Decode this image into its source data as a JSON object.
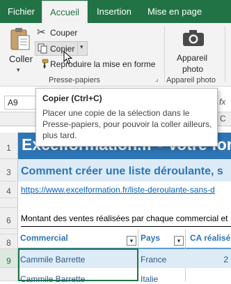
{
  "colors": {
    "excel_green": "#217346",
    "ribbon_bg": "#f3f3f3",
    "title_blue": "#2e75b5",
    "row_blue": "#ddebf7",
    "link_blue": "#0563c1"
  },
  "ribbon": {
    "tabs": [
      {
        "label": "Fichier",
        "active": false
      },
      {
        "label": "Accueil",
        "active": true
      },
      {
        "label": "Insertion",
        "active": false
      },
      {
        "label": "Mise en page",
        "active": false
      }
    ],
    "clipboard": {
      "paste_label": "Coller",
      "cut_label": "Couper",
      "copy_label": "Copier",
      "format_painter_label": "Reproduire la mise en forme",
      "group_label": "Presse-papiers"
    },
    "photo": {
      "button_line1": "Appareil",
      "button_line2": "photo",
      "group_label": "Appareil photo"
    }
  },
  "formula_bar": {
    "name_box": "A9",
    "fx": "fx"
  },
  "tooltip": {
    "title": "Copier (Ctrl+C)",
    "body": "Placer une copie de la sélection dans le Presse-papiers, pour pouvoir la coller ailleurs, plus tard."
  },
  "sheet": {
    "col_c_header": "C",
    "row_numbers": [
      "1",
      "3",
      "4",
      "6",
      "8",
      "9"
    ],
    "banner": "Excelformation.fr - Votre formation",
    "subtitle": "Comment créer une liste déroulante, s",
    "link": "https://www.excelformation.fr/liste-deroulante-sans-d",
    "description": "Montant des ventes réalisées par chaque commercial et",
    "table_headers": [
      "Commercial",
      "Pays",
      "CA réalisé"
    ],
    "rows": [
      {
        "commercial": "Cammile Barrette",
        "pays": "France",
        "ca": "2"
      },
      {
        "commercial": "Cammile Barrette",
        "pays": "Italie",
        "ca": ""
      }
    ]
  }
}
